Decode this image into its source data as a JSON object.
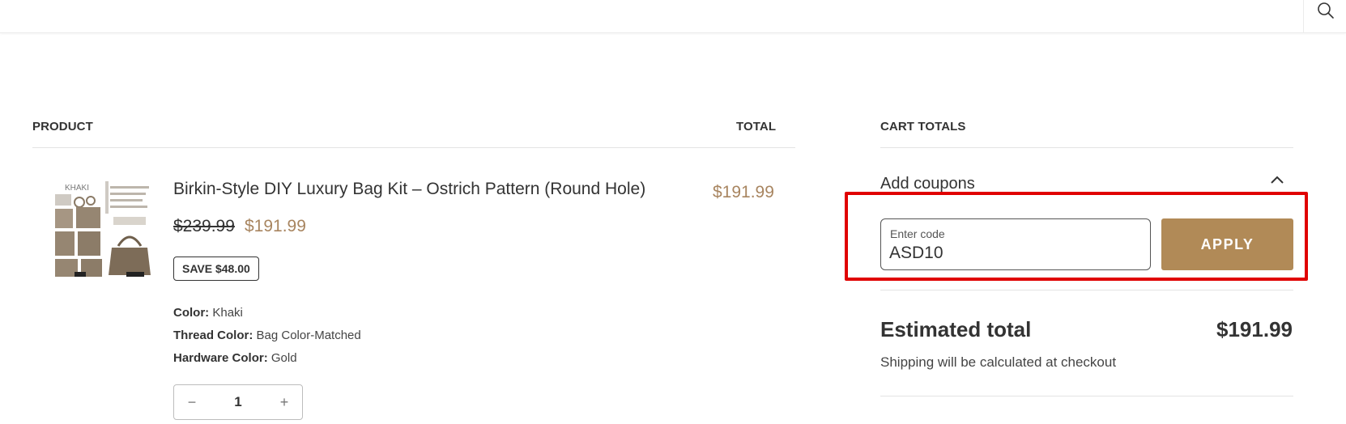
{
  "header": {
    "search_icon": "search-icon"
  },
  "table": {
    "product_header": "PRODUCT",
    "total_header": "TOTAL"
  },
  "item": {
    "thumbnail_text": "KHAKI",
    "name": "Birkin-Style DIY Luxury Bag Kit – Ostrich Pattern (Round Hole)",
    "line_total": "$191.99",
    "original_price": "$239.99",
    "sale_price": "$191.99",
    "save_badge": "SAVE $48.00",
    "options": [
      {
        "label": "Color:",
        "value": "Khaki"
      },
      {
        "label": "Thread Color:",
        "value": "Bag Color-Matched"
      },
      {
        "label": "Hardware Color:",
        "value": "Gold"
      }
    ],
    "quantity": "1",
    "qty_decrease": "−",
    "qty_increase": "+"
  },
  "cart_totals": {
    "heading": "CART TOTALS",
    "coupons_label": "Add coupons",
    "coupon_field_label": "Enter code",
    "coupon_value": "ASD10",
    "apply_label": "APPLY",
    "estimated_total_label": "Estimated total",
    "estimated_total_value": "$191.99",
    "shipping_note": "Shipping will be calculated at checkout"
  },
  "colors": {
    "accent": "#b18a57",
    "price": "#a88560",
    "highlight": "#e00000"
  }
}
